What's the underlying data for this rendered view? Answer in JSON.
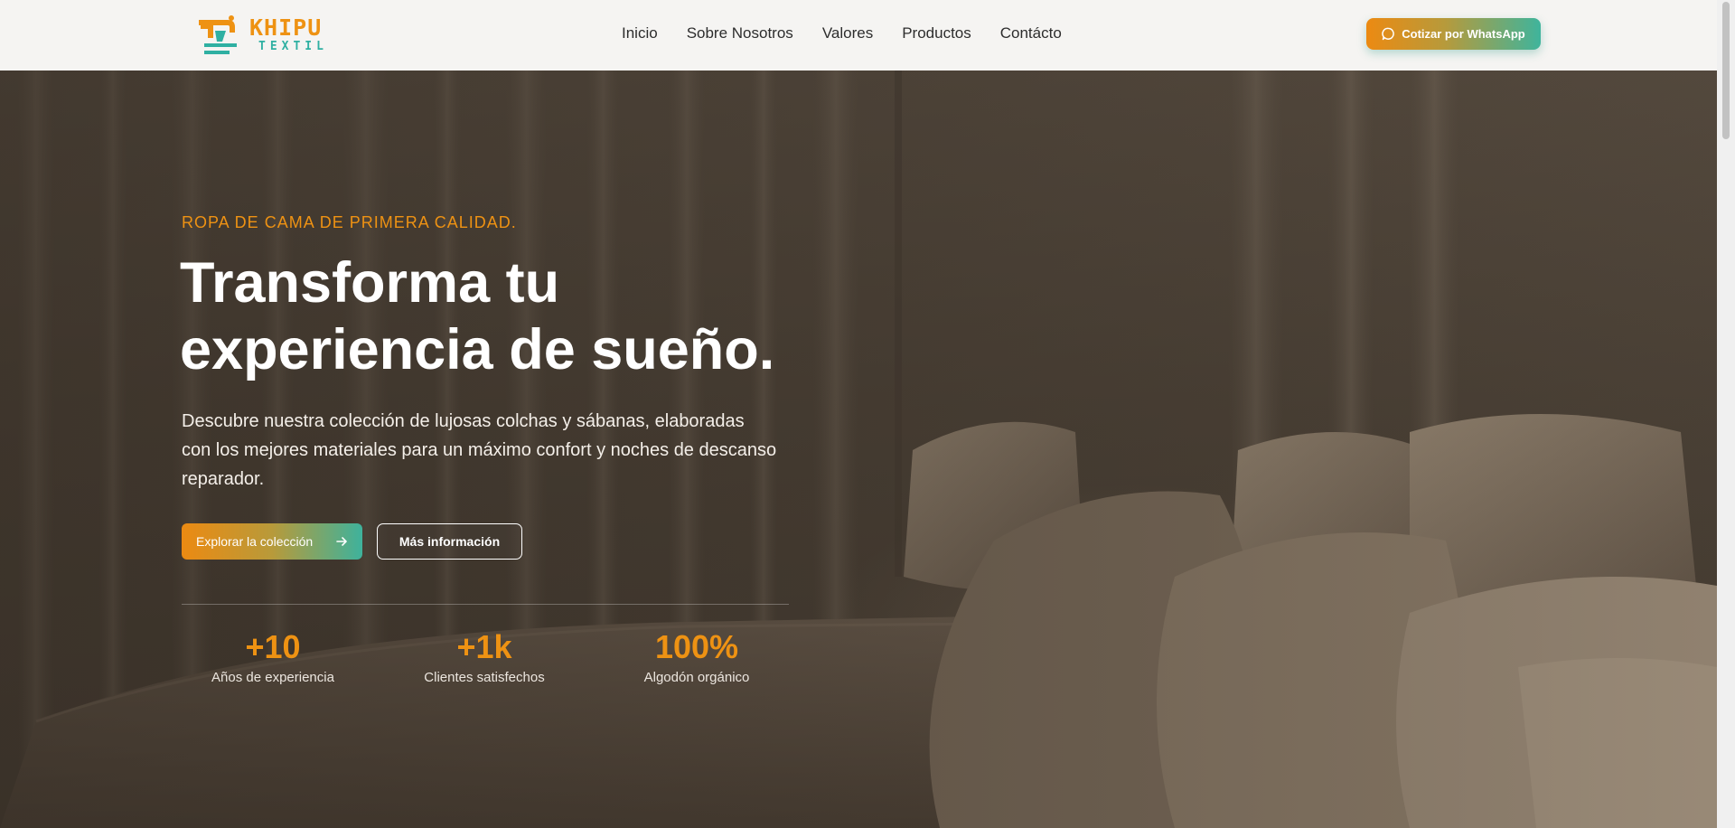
{
  "brand": {
    "name": "KHIPU",
    "sub": "TEXTIL",
    "colors": {
      "orange": "#ee9213",
      "teal": "#2fb0a2"
    }
  },
  "nav": {
    "items": [
      "Inicio",
      "Sobre Nosotros",
      "Valores",
      "Productos",
      "Contácto"
    ]
  },
  "header": {
    "cta_label": "Cotizar por WhatsApp",
    "cta_icon": "chat-bubble-icon"
  },
  "hero": {
    "eyebrow": "ROPA DE CAMA DE PRIMERA CALIDAD.",
    "title_line1": "Transforma tu",
    "title_line2": "experiencia de sueño.",
    "lead": "Descubre nuestra colección de lujosas colchas y sábanas, elaboradas con los mejores materiales para un máximo confort y noches de descanso reparador.",
    "primary_label": "Explorar la colección",
    "primary_icon": "arrow-right-icon",
    "secondary_label": "Más información",
    "background": "bedroom-photo-pillows-and-curtains"
  },
  "stats": [
    {
      "value": "+10",
      "label": "Años de experiencia"
    },
    {
      "value": "+1k",
      "label": "Clientes satisfechos"
    },
    {
      "value": "100%",
      "label": "Algodón orgánico"
    }
  ]
}
